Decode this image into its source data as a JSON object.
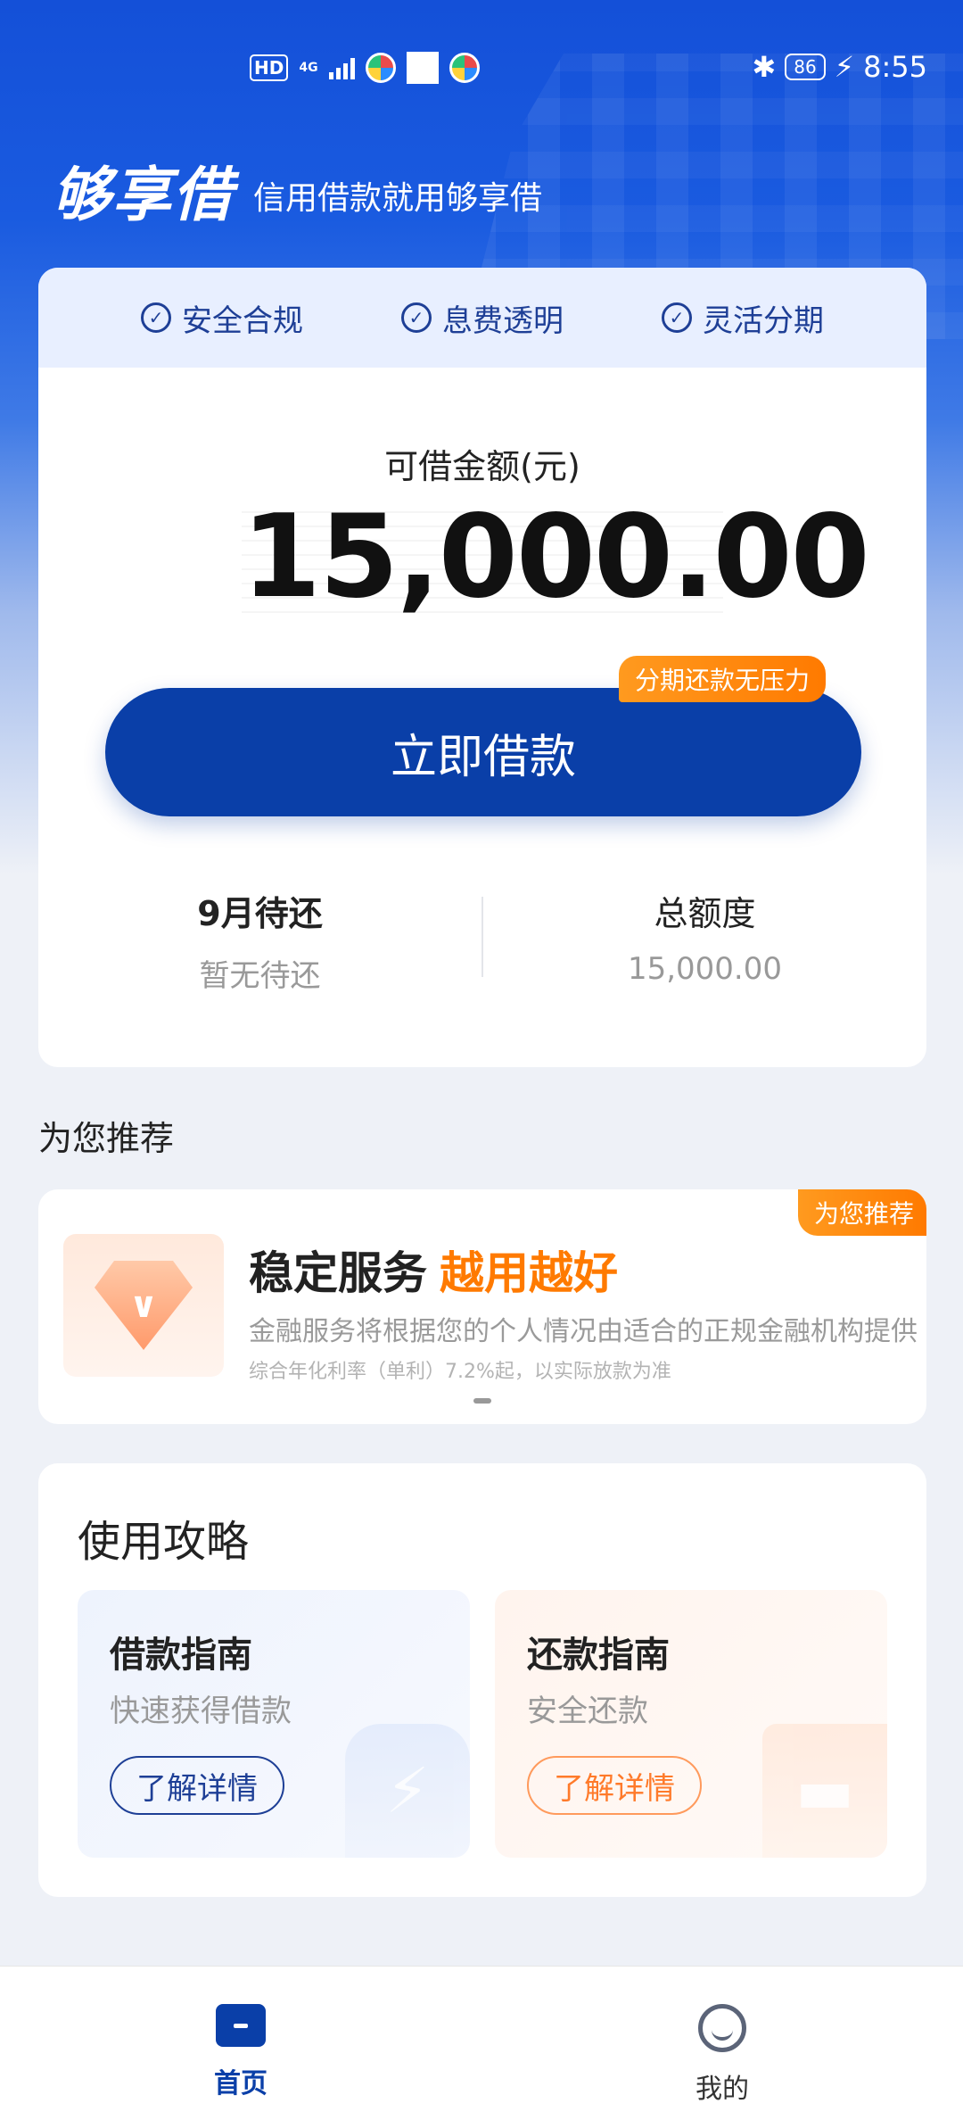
{
  "status_bar": {
    "hd": "HD",
    "network": "4G",
    "battery": "86",
    "time": "8:55"
  },
  "brand": {
    "logo_text": "够享借",
    "slogan": "信用借款就用够享借"
  },
  "features": [
    "安全合规",
    "息费透明",
    "灵活分期"
  ],
  "loan": {
    "amount_label": "可借金额(元)",
    "amount_value": "15,000.00",
    "cta_label": "立即借款",
    "cta_badge": "分期还款无压力"
  },
  "stats": {
    "due_title": "9月待还",
    "due_value": "暂无待还",
    "limit_title": "总额度",
    "limit_value": "15,000.00"
  },
  "recommend": {
    "heading": "为您推荐",
    "badge": "为您推荐",
    "title": "稳定服务",
    "title_highlight": "越用越好",
    "desc": "金融服务将根据您的个人情况由适合的正规金融机构提供",
    "note": "综合年化利率（单利）7.2%起，以实际放款为准"
  },
  "guides": {
    "heading": "使用攻略",
    "borrow": {
      "title": "借款指南",
      "subtitle": "快速获得借款",
      "button": "了解详情"
    },
    "repay": {
      "title": "还款指南",
      "subtitle": "安全还款",
      "button": "了解详情"
    }
  },
  "tabbar": {
    "home": "首页",
    "me": "我的"
  },
  "colors": {
    "primary": "#0a3fa8",
    "accent": "#ff7a00",
    "background": "#eef1f7"
  }
}
